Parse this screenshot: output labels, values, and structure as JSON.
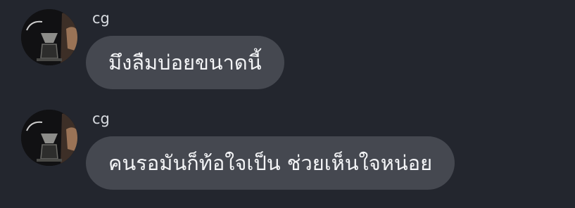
{
  "conversation": {
    "messages": [
      {
        "sender": "cg",
        "avatar_icon": "profile-photo-coffee-dripper",
        "text": "มึงลืมบ่อยขนาดนี้"
      },
      {
        "sender": "cg",
        "avatar_icon": "profile-photo-coffee-dripper",
        "text": "คนรอมันก็ท้อใจเป็น ช่วยเห็นใจหน่อย"
      }
    ]
  },
  "colors": {
    "background": "#23262e",
    "bubble": "#454850",
    "bubble_text": "#f3f4f6",
    "sender_text": "#d8dbe0"
  }
}
